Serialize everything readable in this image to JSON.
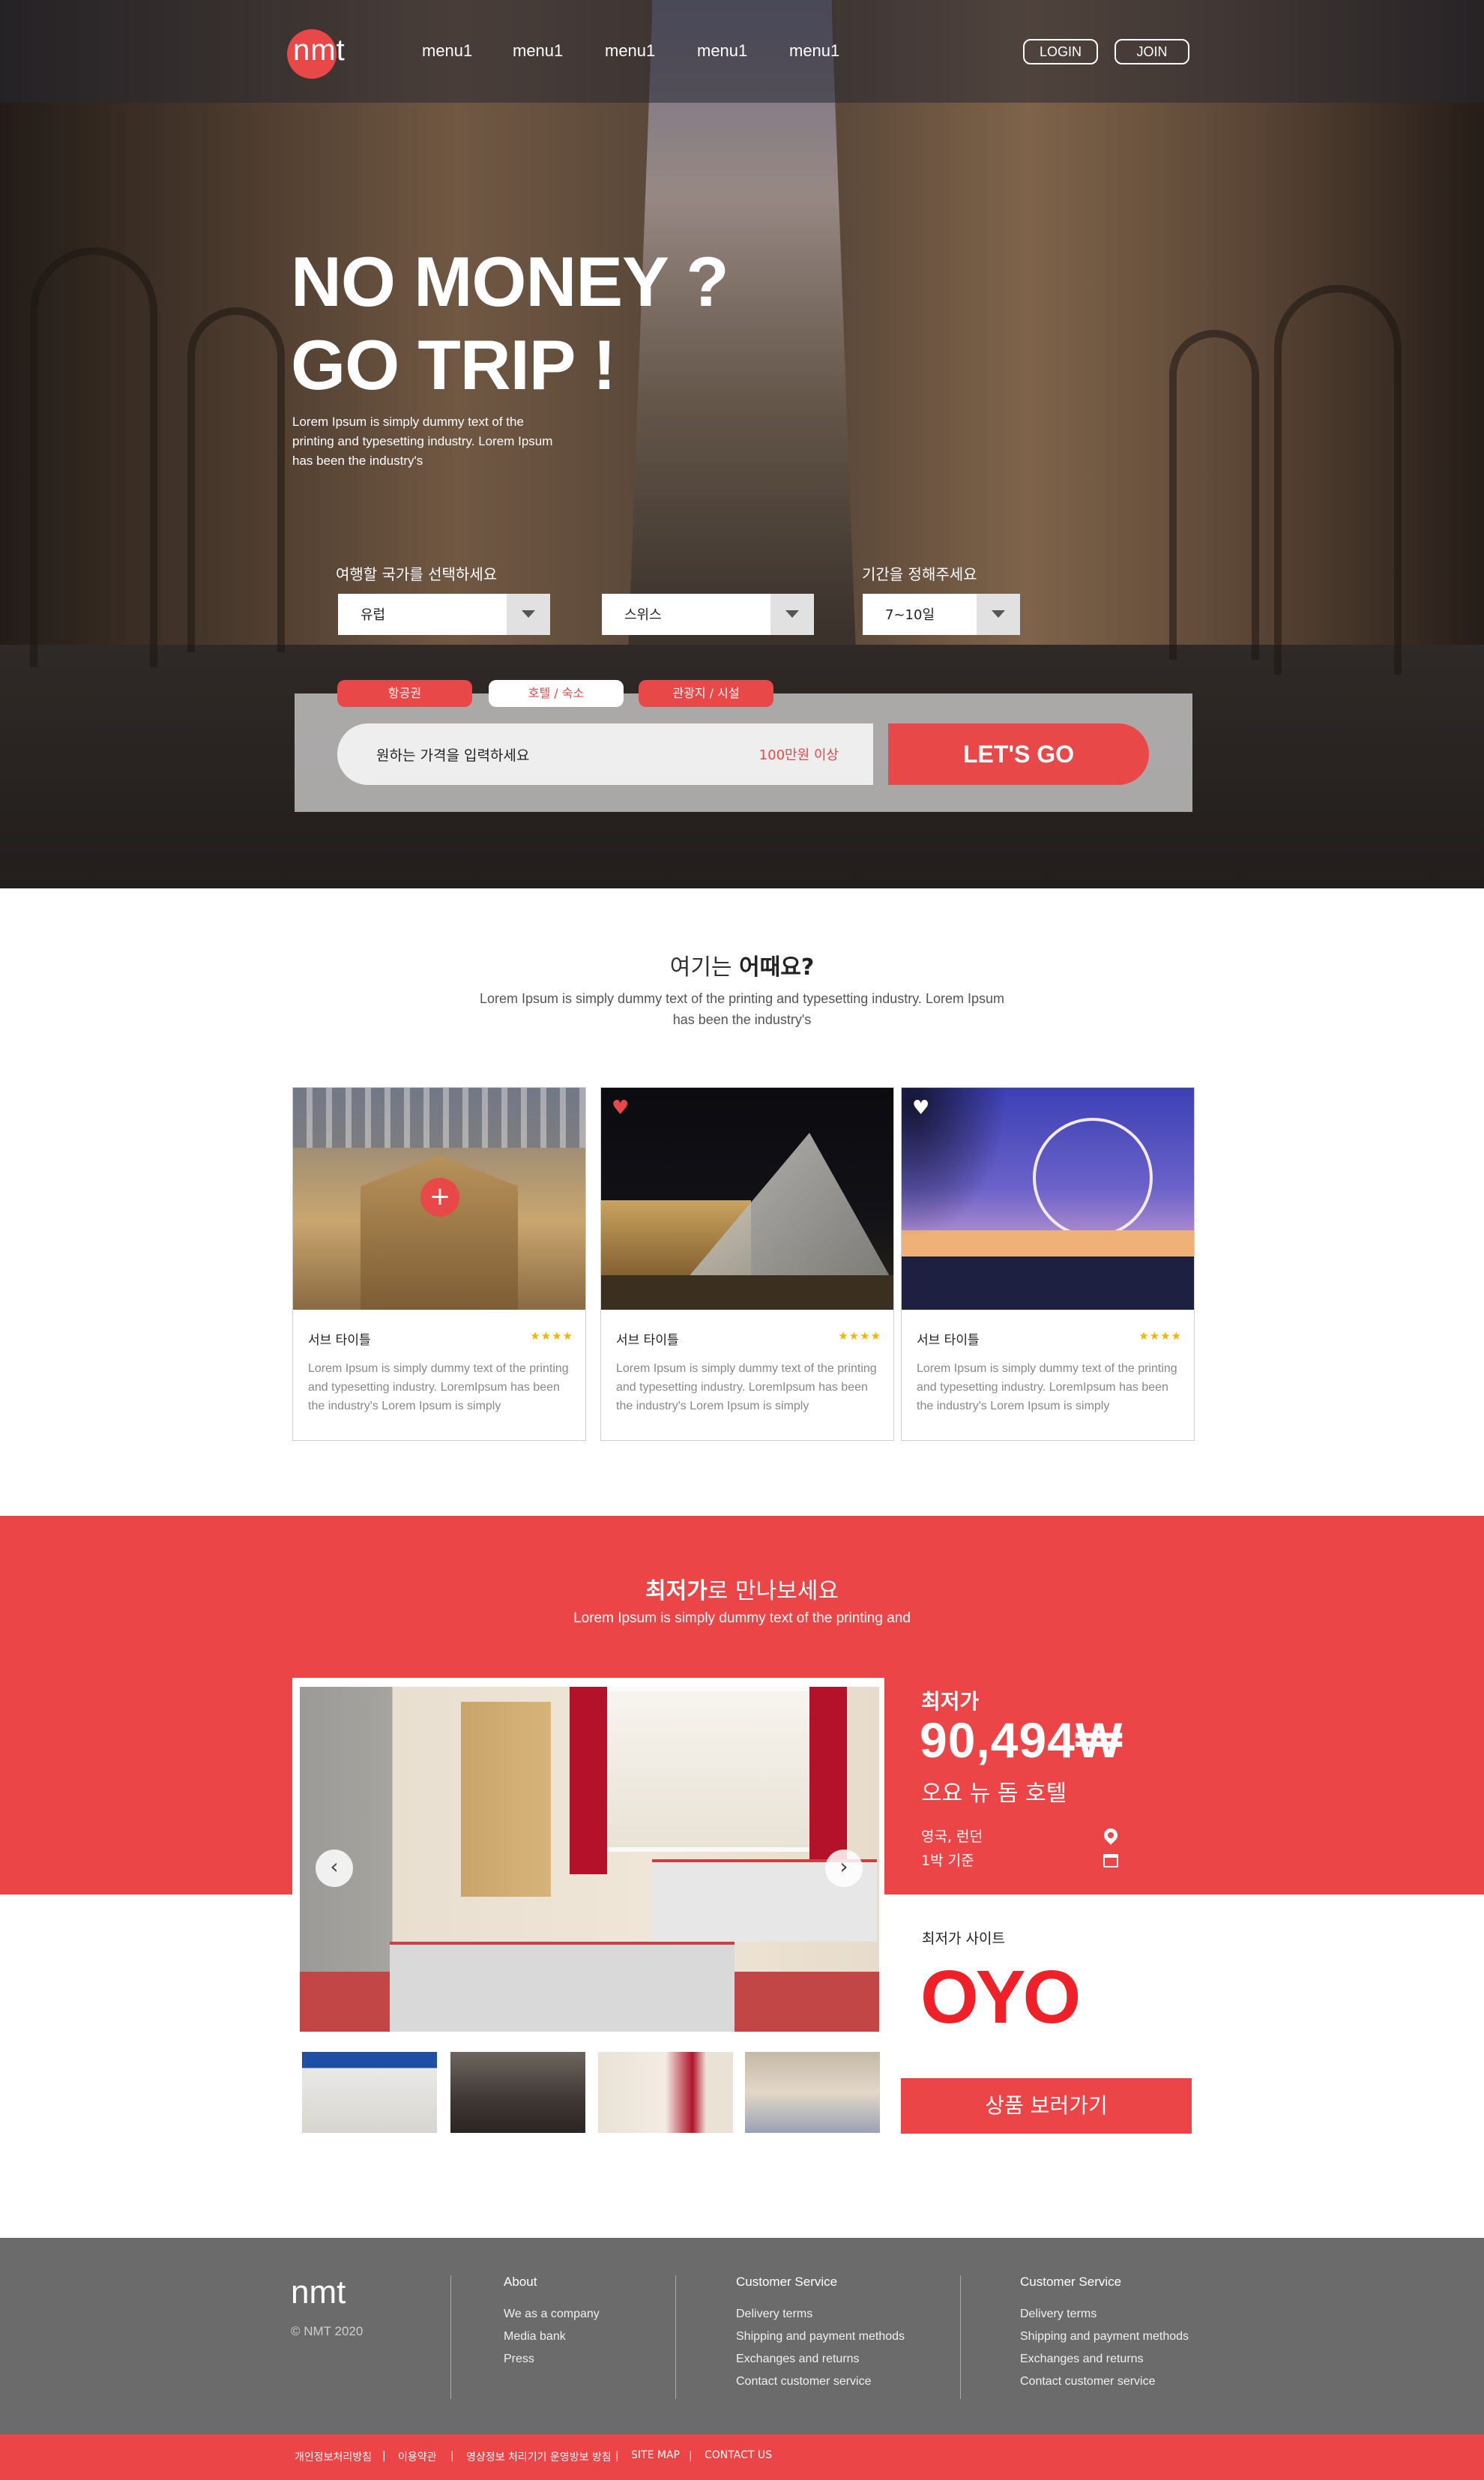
{
  "brand": {
    "logo": "nmt",
    "accent": "#e94849"
  },
  "nav": {
    "items": [
      "menu1",
      "menu1",
      "menu1",
      "menu1",
      "menu1"
    ],
    "login": "LOGIN",
    "join": "JOIN"
  },
  "hero": {
    "title_line1": "NO MONEY ?",
    "title_line2": "GO TRIP !",
    "desc": "Lorem Ipsum is simply dummy text of the printing and typesetting industry. Lorem Ipsum has been the industry's",
    "country_label": "여행할 국가를 선택하세요",
    "period_label": "기간을 정해주세요",
    "select_region": "유럽",
    "select_country": "스위스",
    "select_period": "7~10일",
    "tabs": [
      "항공권",
      "호텔 / 숙소",
      "관광지 / 시설"
    ],
    "price_placeholder": "원하는 가격을 입력하세요",
    "price_tag": "100만원 이상",
    "go_button": "LET'S GO"
  },
  "recommend": {
    "title_light": "여기는 ",
    "title_bold": "어때요?",
    "desc": "Lorem Ipsum is simply dummy text of the printing and typesetting industry. Lorem Ipsum has been the industry's",
    "cards": [
      {
        "title": "서브 타이틀",
        "stars": "★★★★",
        "text": "Lorem Ipsum is simply dummy text of the printing and typesetting industry. LoremIpsum has been the industry's Lorem Ipsum is simply",
        "icon": "plus-icon"
      },
      {
        "title": "서브 타이틀",
        "stars": "★★★★",
        "text": "Lorem Ipsum is simply dummy text of the printing and typesetting industry. LoremIpsum has been the industry's Lorem Ipsum is simply",
        "icon": "heart-icon"
      },
      {
        "title": "서브 타이틀",
        "stars": "★★★★",
        "text": "Lorem Ipsum is simply dummy text of the printing and typesetting industry. LoremIpsum has been the industry's Lorem Ipsum is simply",
        "icon": "heart-icon"
      }
    ]
  },
  "lowest": {
    "title_bold": "최저가",
    "title_light": "로 만나보세요",
    "desc": "Lorem Ipsum is simply dummy text of the printing and",
    "label": "최저가",
    "price": "90,494₩",
    "hotel": "오요 뉴 돔 호텔",
    "location": "영국, 런던",
    "night": "1박 기준",
    "site_label": "최저가 사이트",
    "site_logo": "OYO",
    "view_button": "상품 보러가기",
    "prev_icon": "‹",
    "next_icon": "›"
  },
  "footer": {
    "logo": "nmt",
    "copyright": "© NMT 2020",
    "col1": {
      "head": "About",
      "links": [
        "We as a company",
        "Media bank",
        "Press"
      ]
    },
    "col2": {
      "head": "Customer Service",
      "links": [
        "Delivery terms",
        "Shipping and payment methods",
        "Exchanges and returns",
        "Contact customer service"
      ]
    },
    "col3": {
      "head": "Customer Service",
      "links": [
        "Delivery terms",
        "Shipping and payment methods",
        "Exchanges and returns",
        "Contact customer service"
      ]
    },
    "bottom_links": [
      "개인정보처리방침",
      "이용약관",
      "영상정보 처리기기 운영방보 방침",
      "SITE MAP",
      "CONTACT US"
    ]
  }
}
